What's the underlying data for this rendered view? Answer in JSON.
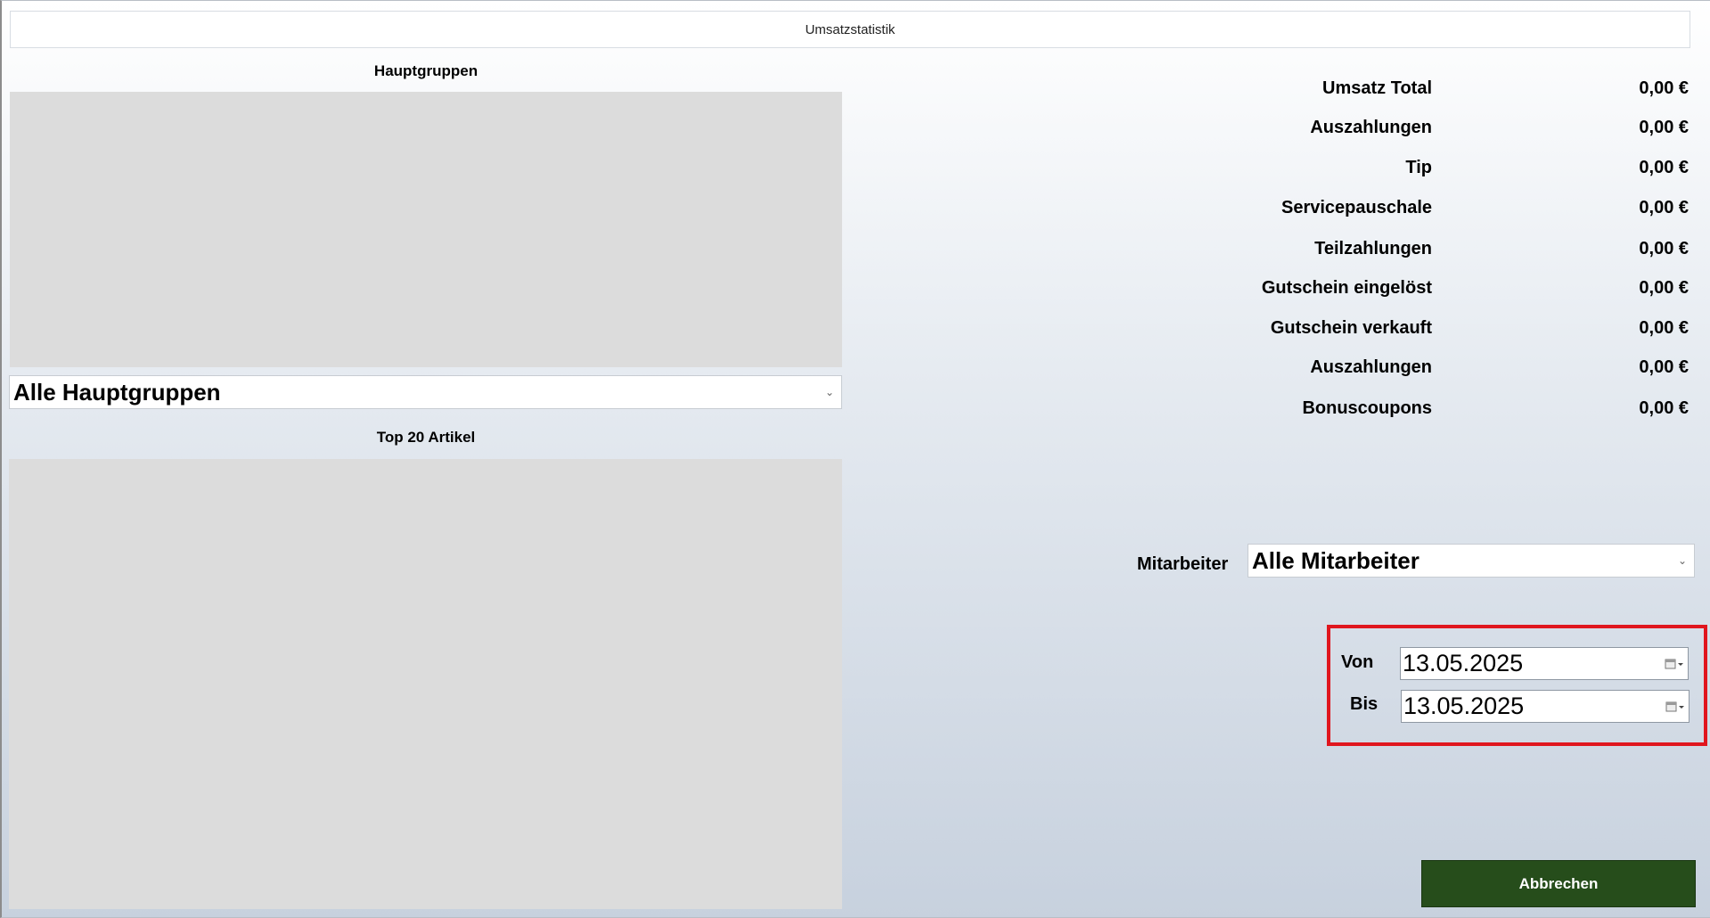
{
  "window": {
    "title": "Umsatzstatistik"
  },
  "left": {
    "hauptgruppen_label": "Hauptgruppen",
    "hauptgruppen_select": "Alle Hauptgruppen",
    "top_articles_label": "Top 20 Artikel"
  },
  "stats": [
    {
      "label": "Umsatz Total",
      "value": "0,00 €"
    },
    {
      "label": "Auszahlungen",
      "value": "0,00 €"
    },
    {
      "label": "Tip",
      "value": "0,00 €"
    },
    {
      "label": "Servicepauschale",
      "value": "0,00 €"
    },
    {
      "label": "Teilzahlungen",
      "value": "0,00 €"
    },
    {
      "label": "Gutschein eingelöst",
      "value": "0,00 €"
    },
    {
      "label": "Gutschein verkauft",
      "value": "0,00 €"
    },
    {
      "label": "Auszahlungen",
      "value": "0,00 €"
    },
    {
      "label": "Bonuscoupons",
      "value": "0,00 €"
    }
  ],
  "employee": {
    "label": "Mitarbeiter",
    "value": "Alle Mitarbeiter"
  },
  "date_range": {
    "from_label": "Von",
    "from_value": "13.05.2025",
    "to_label": "Bis",
    "to_value": "13.05.2025"
  },
  "actions": {
    "cancel_label": "Abbrechen"
  },
  "colors": {
    "button_bg": "#264d1b",
    "highlight": "#e0161e",
    "chart_bg": "#dcdcdc"
  }
}
